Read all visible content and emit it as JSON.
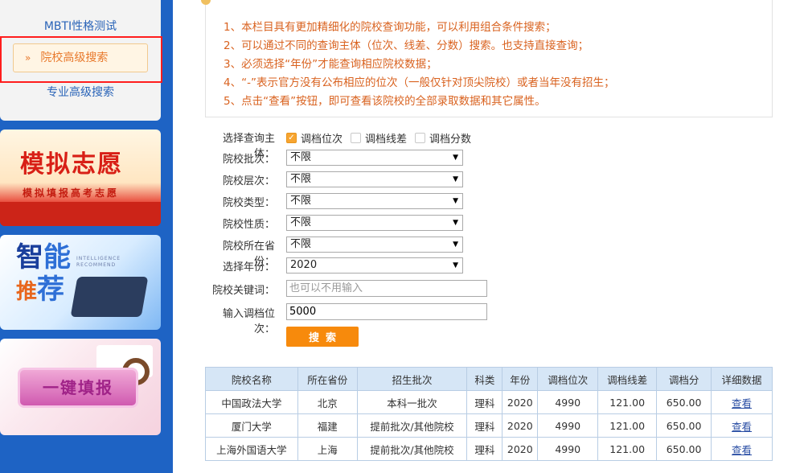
{
  "sidebar": {
    "menu": [
      {
        "label": "MBTI性格测试"
      },
      {
        "label": "院校高级搜索",
        "active": true,
        "arrow": "»"
      },
      {
        "label": "专业高级搜索"
      }
    ],
    "banners": {
      "mock": {
        "title": "模拟志愿",
        "subtitle": "模拟填报高考志愿"
      },
      "smart": {
        "title_a": "智",
        "title_b": "能",
        "title_c": "推",
        "title_d": "荐",
        "sub": "INTELLIGENCE RECOMMEND"
      },
      "quick": {
        "title": "一键填报"
      }
    }
  },
  "notes": [
    "1、本栏目具有更加精细化的院校查询功能，可以利用组合条件搜索；",
    "2、可以通过不同的查询主体（位次、线差、分数）搜索。也支持直接查询；",
    "3、必须选择“年份”才能查询相应院校数据；",
    "4、“-”表示官方没有公布相应的位次（一般仅针对顶尖院校）或者当年没有招生；",
    "5、点击“查看”按钮，即可查看该院校的全部录取数据和其它属性。"
  ],
  "form": {
    "subject_label": "选择查询主体：",
    "subjects": [
      {
        "label": "调档位次",
        "checked": true,
        "check_mark": "✓"
      },
      {
        "label": "调档线差",
        "checked": false
      },
      {
        "label": "调档分数",
        "checked": false
      }
    ],
    "batch": {
      "label": "院校批次：",
      "value": "不限"
    },
    "level": {
      "label": "院校层次：",
      "value": "不限"
    },
    "type": {
      "label": "院校类型：",
      "value": "不限"
    },
    "nature": {
      "label": "院校性质：",
      "value": "不限"
    },
    "province": {
      "label": "院校所在省份：",
      "value": "不限"
    },
    "year": {
      "label": "选择年份：",
      "value": "2020"
    },
    "keyword": {
      "label": "院校关键词：",
      "placeholder": "也可以不用输入",
      "value": ""
    },
    "rank": {
      "label": "输入调档位次：",
      "value": "5000"
    },
    "caret": "▼",
    "search_label": "搜索"
  },
  "table": {
    "headers": [
      "院校名称",
      "所在省份",
      "招生批次",
      "科类",
      "年份",
      "调档位次",
      "调档线差",
      "调档分",
      "详细数据"
    ],
    "rows": [
      [
        "中国政法大学",
        "北京",
        "本科一批次",
        "理科",
        "2020",
        "4990",
        "121.00",
        "650.00",
        "查看"
      ],
      [
        "厦门大学",
        "福建",
        "提前批次/其他院校",
        "理科",
        "2020",
        "4990",
        "121.00",
        "650.00",
        "查看"
      ],
      [
        "上海外国语大学",
        "上海",
        "提前批次/其他院校",
        "理科",
        "2020",
        "4990",
        "121.00",
        "650.00",
        "查看"
      ]
    ]
  },
  "colors": {
    "sidebar": "#1e63c4",
    "accent": "#f78a0c",
    "notes_text": "#d9621f",
    "table_header": "#d6e6f6",
    "highlight": "#ff1d1d"
  }
}
